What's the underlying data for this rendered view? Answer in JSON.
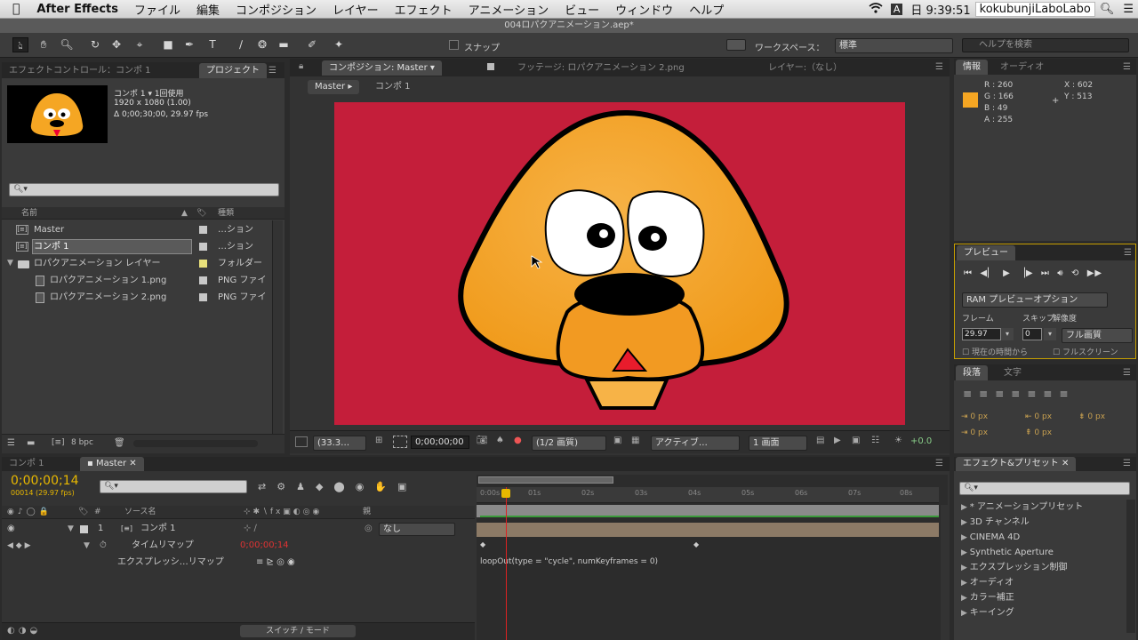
{
  "menubar": {
    "items": [
      "After Effects",
      "ファイル",
      "編集",
      "コンポジション",
      "レイヤー",
      "エフェクト",
      "アニメーション",
      "ビュー",
      "ウィンドウ",
      "ヘルプ"
    ],
    "input_badge": "A",
    "clock": "日 9:39:51",
    "user": "kokubunjiLaboLabo"
  },
  "titlebar": {
    "title": "004ロパクアニメーション.aep*"
  },
  "toolbar": {
    "snap_label": "スナップ",
    "workspace_label": "ワークスペース：",
    "workspace_value": "標準",
    "help_placeholder": "ヘルプを検索"
  },
  "left_panel": {
    "tab_effects": "エフェクトコントロール：コンポ 1",
    "tab_project": "プロジェクト",
    "comp_name": "コンポ 1 ▾ 1回使用",
    "comp_size": "1920 x 1080 (1.00)",
    "comp_duration": "Δ 0;00;30;00, 29.97 fps",
    "col_name": "名前",
    "col_type": "種類",
    "items": [
      {
        "name": "Master",
        "type": "…ション",
        "swatch": "#c8c8c8"
      },
      {
        "name": "コンポ 1",
        "type": "…ション",
        "swatch": "#c8c8c8"
      },
      {
        "name": "ロパクアニメーション レイヤー",
        "type": "フォルダー",
        "swatch": "#e8e07a"
      },
      {
        "name": "ロパクアニメーション 1.png",
        "type": "PNG ファイ",
        "swatch": "#c8c8c8"
      },
      {
        "name": "ロパクアニメーション 2.png",
        "type": "PNG ファイ",
        "swatch": "#c8c8c8"
      }
    ],
    "bpc": "8 bpc"
  },
  "comp_panel": {
    "tab_comp": "コンポジション: Master",
    "tab_footage": "フッテージ: ロパクアニメーション 2.png",
    "tab_layer": "レイヤー:（なし）",
    "crumb_master": "Master",
    "crumb_comp": "コンポ 1",
    "zoom": "(33.3…",
    "timecode": "0;00;00;00",
    "resolution": "(1/2 画質)",
    "view": "アクティブ…",
    "views": "1 画面",
    "exposure": "+0.0",
    "bg_color": "#c41e3a"
  },
  "info_panel": {
    "tab_info": "情報",
    "tab_audio": "オーディオ",
    "r": "R : 260",
    "g": "G : 166",
    "b": "B : 49",
    "a": "A : 255",
    "x": "X : 602",
    "y": "Y : 513",
    "swatch": "#f5a623"
  },
  "preview_panel": {
    "tab": "プレビュー",
    "ram_option": "RAM プレビューオプション",
    "frame_label": "フレーム",
    "skip_label": "スキップ",
    "res_label": "解像度",
    "fps_value": "29.97",
    "skip_value": "0",
    "res_value": "フル画質",
    "from_current": "現在の時間から",
    "fullscreen": "フルスクリーン"
  },
  "paragraph_panel": {
    "tab_para": "段落",
    "tab_char": "文字",
    "indents": [
      "0 px",
      "0 px",
      "0 px",
      "0 px",
      "0 px"
    ]
  },
  "effects_panel": {
    "tab": "エフェクト&プリセット",
    "items": [
      "* アニメーションプリセット",
      "3D チャンネル",
      "CINEMA 4D",
      "Synthetic Aperture",
      "エクスプレッション制御",
      "オーディオ",
      "カラー補正",
      "キーイング"
    ]
  },
  "timeline": {
    "tab_comp1": "コンポ 1",
    "tab_master": "Master",
    "timecode": "0;00;00;14",
    "frames": "00014 (29.97 fps)",
    "col_source": "ソース名",
    "col_parent": "親",
    "layer_num": "1",
    "layer_name": "コンポ 1",
    "parent_value": "なし",
    "prop_name": "タイムリマップ",
    "prop_value": "0;00;00;14",
    "expr_name": "エクスプレッシ…リマップ",
    "expression": "loopOut(type = \"cycle\", numKeyframes = 0)",
    "switch_mode": "スイッチ / モード",
    "ticks": [
      "0:00s",
      "01s",
      "02s",
      "03s",
      "04s",
      "05s",
      "06s",
      "07s",
      "08s"
    ]
  }
}
